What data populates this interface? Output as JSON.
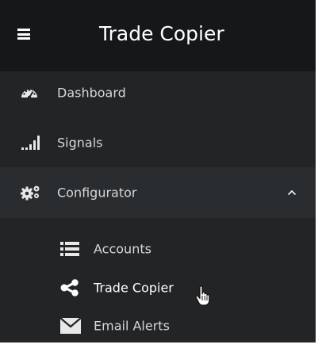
{
  "header": {
    "menu_icon": "hamburger-icon",
    "title": "Trade Copier"
  },
  "nav": {
    "items": [
      {
        "label": "Dashboard",
        "icon": "dashboard-gauge-icon"
      },
      {
        "label": "Signals",
        "icon": "signal-bars-icon"
      },
      {
        "label": "Configurator",
        "icon": "cogs-icon",
        "expanded": true,
        "chevron": "chevron-up-icon"
      }
    ],
    "sub_items": [
      {
        "label": "Accounts",
        "icon": "list-icon"
      },
      {
        "label": "Trade Copier",
        "icon": "share-icon",
        "active": true
      },
      {
        "label": "Email Alerts",
        "icon": "envelope-icon"
      }
    ]
  },
  "colors": {
    "header_bg": "#161718",
    "sidebar_bg": "#222426",
    "expanded_group_bg": "#2a2d30",
    "text": "#d7d7d7",
    "active_text": "#ffffff"
  }
}
